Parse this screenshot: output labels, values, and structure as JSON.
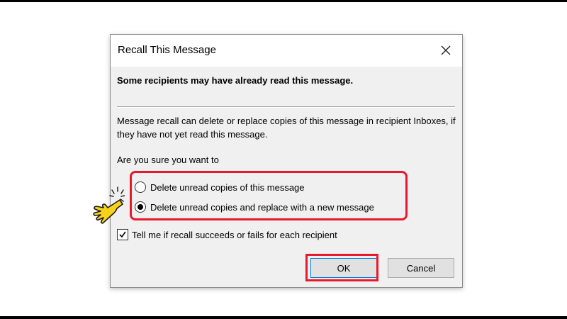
{
  "dialog": {
    "title": "Recall This Message",
    "close_icon": "close-icon",
    "headline": "Some recipients may have already read this message.",
    "description": "Message recall can delete or replace copies of this message in recipient Inboxes, if they have not yet read this message.",
    "prompt": "Are you sure you want to",
    "options": [
      {
        "label": "Delete unread copies of this message",
        "selected": false
      },
      {
        "label": "Delete unread copies and replace with a new message",
        "selected": true
      }
    ],
    "notify": {
      "label": "Tell me if recall succeeds or fails for each recipient",
      "checked": true
    },
    "buttons": {
      "ok": "OK",
      "cancel": "Cancel"
    }
  },
  "annotations": {
    "highlight_color": "#e8192c",
    "pointer_icon": "hand-pointer-icon",
    "pointer_color": "#f7d21b"
  }
}
